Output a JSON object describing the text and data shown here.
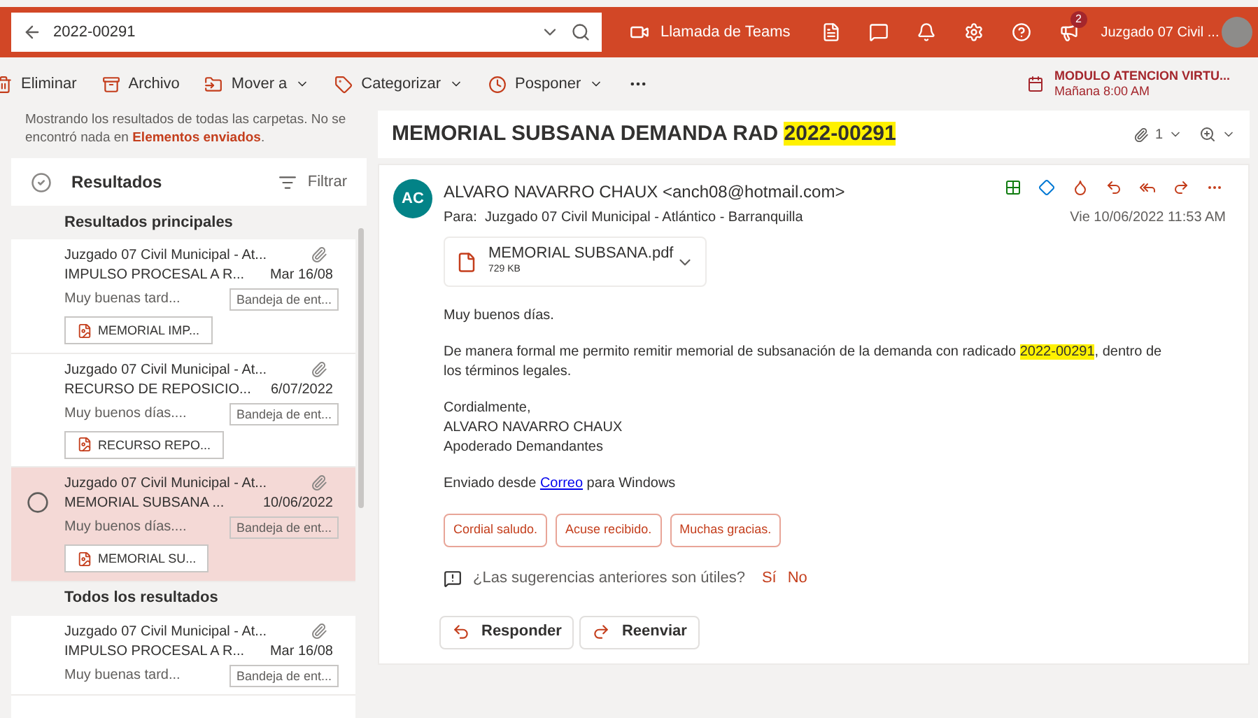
{
  "search": {
    "value": "2022-00291"
  },
  "header_bar": {
    "teams_call": "Llamada de Teams",
    "notification_count": "2",
    "account": "Juzgado 07 Civil ..."
  },
  "toolbar": {
    "items": [
      {
        "kind": "delete",
        "label": "Eliminar",
        "has_menu": false
      },
      {
        "kind": "archive",
        "label": "Archivo",
        "has_menu": false
      },
      {
        "kind": "move",
        "label": "Mover a",
        "has_menu": true
      },
      {
        "kind": "tag",
        "label": "Categorizar",
        "has_menu": true
      },
      {
        "kind": "snooze",
        "label": "Posponer",
        "has_menu": true
      }
    ],
    "reminder": {
      "title": "MODULO ATENCION VIRTU...",
      "time": "Mañana 8:00 AM"
    }
  },
  "results": {
    "notice": "Mostrando los resultados de todas las carpetas. No se encontró nada en **Elementos enviados**.",
    "title": "Resultados",
    "filter": "Filtrar",
    "groups": [
      {
        "heading": "Resultados principales",
        "messages": [
          {
            "sender": "Juzgado 07 Civil Municipal - At...",
            "subject": "IMPULSO PROCESAL A R...",
            "date": "Mar 16/08",
            "preview": "Muy buenas tard...",
            "folder": "Bandeja de ent...",
            "attachment": "MEMORIAL IMP...",
            "selected": false
          },
          {
            "sender": "Juzgado 07 Civil Municipal - At...",
            "subject": "RECURSO DE REPOSICIO...",
            "date": "6/07/2022",
            "preview": "Muy buenos días....",
            "folder": "Bandeja de ent...",
            "attachment": "RECURSO REPO...",
            "selected": false
          },
          {
            "sender": "Juzgado 07 Civil Municipal - At...",
            "subject": "MEMORIAL SUBSANA ...",
            "date": "10/06/2022",
            "preview": "Muy buenos días....",
            "folder": "Bandeja de ent...",
            "attachment": "MEMORIAL SU...",
            "selected": true
          }
        ]
      },
      {
        "heading": "Todos los resultados",
        "messages": [
          {
            "sender": "Juzgado 07 Civil Municipal - At...",
            "subject": "IMPULSO PROCESAL A R...",
            "date": "Mar 16/08",
            "preview": "Muy buenas tard...",
            "folder": "Bandeja de ent...",
            "selected": false
          }
        ]
      }
    ]
  },
  "reading": {
    "title": [
      {
        "text": "MEMORIAL SUBSANA DEMANDA RAD ",
        "highlighted": false
      },
      {
        "text": "2022-00291",
        "highlighted": true
      }
    ],
    "attachment_count": "1",
    "email": {
      "initials": "AC",
      "from": "ALVARO NAVARRO CHAUX <anch08@hotmail.com>",
      "to": "Para:  Juzgado 07 Civil Municipal - Atlántico - Barranquilla",
      "date": "Vie 10/06/2022 11:53 AM",
      "attachment": {
        "name": "MEMORIAL SUBSANA.pdf",
        "size": "729 KB"
      },
      "paragraphs": [
        [
          {
            "text": "Muy buenos días.",
            "highlighted": false
          }
        ],
        [
          {
            "text": "De manera formal me permito remitir memorial de subsanación de la demanda con radicado ",
            "highlighted": false
          },
          {
            "text": "2022-00291",
            "highlighted": true
          },
          {
            "text": ", dentro de los términos legales.",
            "highlighted": false
          }
        ]
      ],
      "signature": [
        "Cordialmente,",
        "ALVARO NAVARRO CHAUX",
        "Apoderado Demandantes"
      ],
      "sent_from": {
        "before": "Enviado desde ",
        "link": "Correo",
        "after": " para Windows"
      },
      "quick_replies": [
        "Cordial saludo.",
        "Acuse recibido.",
        "Muchas gracias."
      ],
      "feedback": {
        "question": "¿Las sugerencias anteriores son útiles?",
        "yes": "Sí",
        "no": "No"
      },
      "actions": [
        {
          "kind": "reply",
          "label": "Responder"
        },
        {
          "kind": "forward",
          "label": "Reenviar"
        }
      ]
    }
  }
}
